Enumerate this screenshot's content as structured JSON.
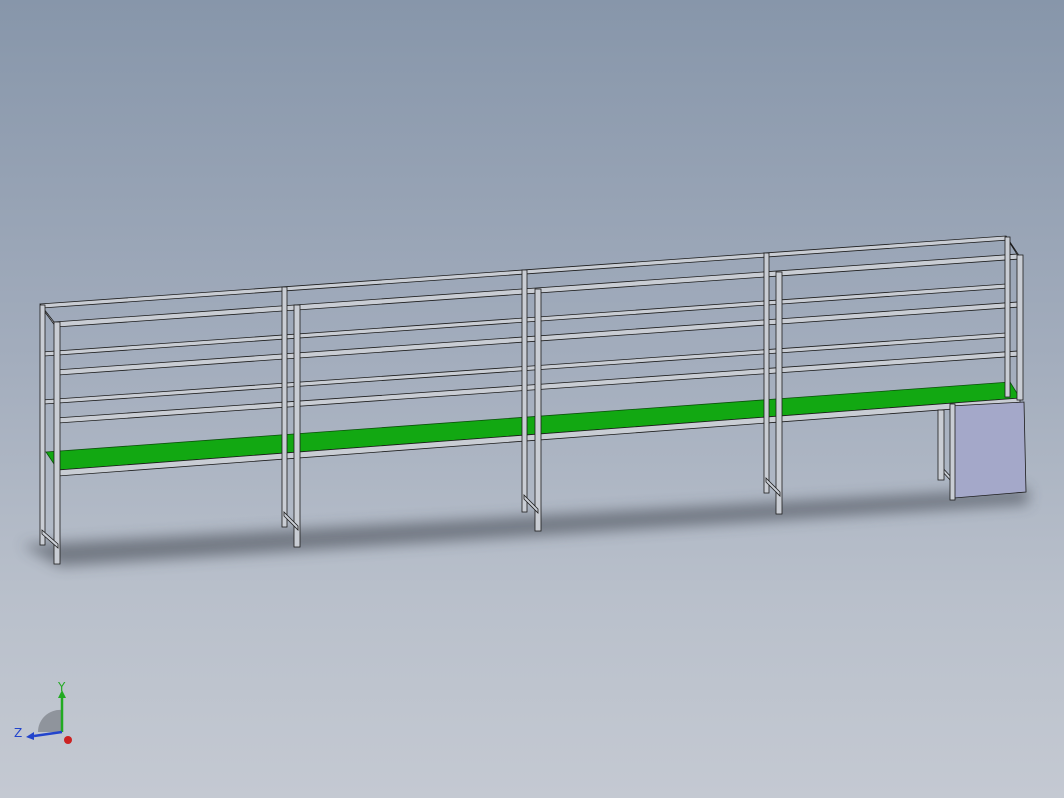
{
  "model": {
    "bays": 4,
    "shelf_levels": 4,
    "colors": {
      "frame_fill": "#c9cdd4",
      "frame_stroke": "#1c1c1c",
      "worktop": "#12a812",
      "worktop_dark": "#0b6f0b",
      "cabinet": "#a4a8c9",
      "shadow": "#3a3f48"
    }
  },
  "triad": {
    "y_label": "Y",
    "z_label": "Z",
    "y_color": "#22aa22",
    "z_color": "#2244cc",
    "x_color": "#cc2222"
  }
}
